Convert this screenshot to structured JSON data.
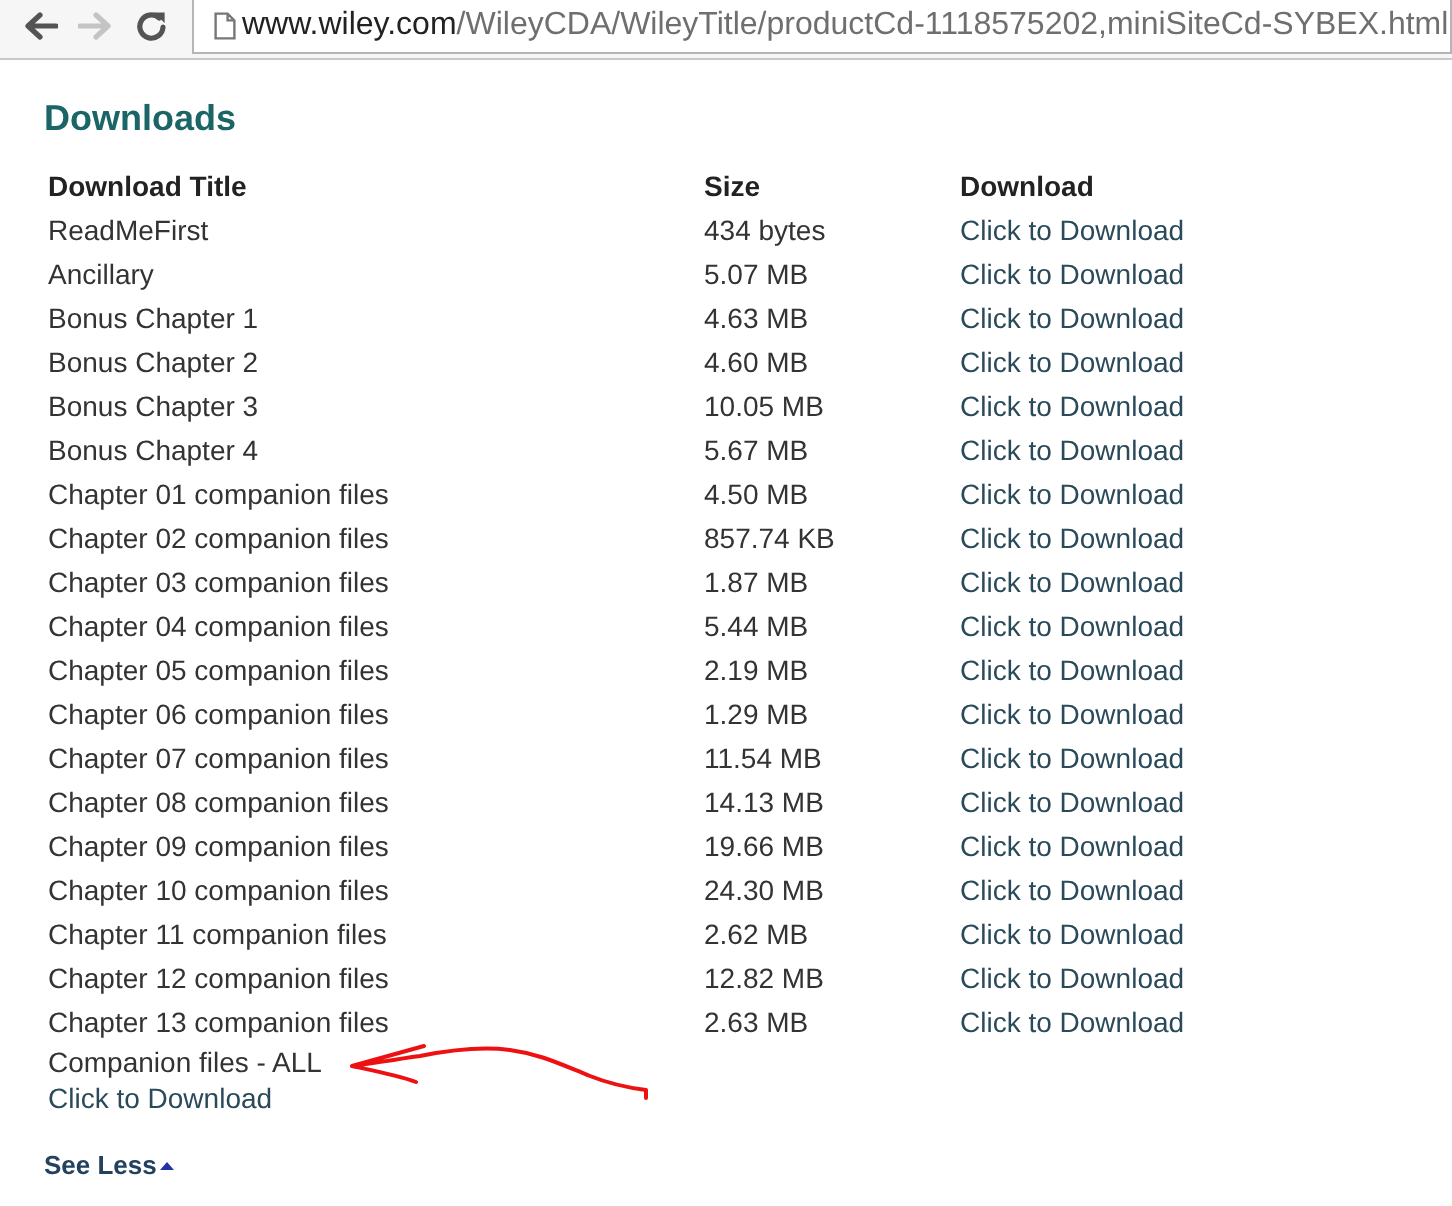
{
  "browser": {
    "nav_buttons": [
      {
        "kind": "back",
        "disabled": false
      },
      {
        "kind": "forward",
        "disabled": true
      },
      {
        "kind": "reload",
        "disabled": false
      }
    ],
    "address": {
      "host": "www.wiley.com",
      "path": "/WileyCDA/WileyTitle/productCd-1118575202,miniSiteCd-SYBEX.html"
    }
  },
  "downloads": {
    "title": "Downloads",
    "table": {
      "columns": [
        "Download Title",
        "Size",
        "Download"
      ],
      "rows": [
        {
          "title": "ReadMeFirst",
          "size": "434 bytes",
          "link": "Click to Download"
        },
        {
          "title": "Ancillary",
          "size": "5.07 MB",
          "link": "Click to Download"
        },
        {
          "title": "Bonus Chapter 1",
          "size": "4.63 MB",
          "link": "Click to Download"
        },
        {
          "title": "Bonus Chapter 2",
          "size": "4.60 MB",
          "link": "Click to Download"
        },
        {
          "title": "Bonus Chapter 3",
          "size": "10.05 MB",
          "link": "Click to Download"
        },
        {
          "title": "Bonus Chapter 4",
          "size": "5.67 MB",
          "link": "Click to Download"
        },
        {
          "title": "Chapter 01 companion files",
          "size": "4.50 MB",
          "link": "Click to Download"
        },
        {
          "title": "Chapter 02 companion files",
          "size": "857.74 KB",
          "link": "Click to Download"
        },
        {
          "title": "Chapter 03 companion files",
          "size": "1.87 MB",
          "link": "Click to Download"
        },
        {
          "title": "Chapter 04 companion files",
          "size": "5.44 MB",
          "link": "Click to Download"
        },
        {
          "title": "Chapter 05 companion files",
          "size": "2.19 MB",
          "link": "Click to Download"
        },
        {
          "title": "Chapter 06 companion files",
          "size": "1.29 MB",
          "link": "Click to Download"
        },
        {
          "title": "Chapter 07 companion files",
          "size": "11.54 MB",
          "link": "Click to Download"
        },
        {
          "title": "Chapter 08 companion files",
          "size": "14.13 MB",
          "link": "Click to Download"
        },
        {
          "title": "Chapter 09 companion files",
          "size": "19.66 MB",
          "link": "Click to Download"
        },
        {
          "title": "Chapter 10 companion files",
          "size": "24.30 MB",
          "link": "Click to Download"
        },
        {
          "title": "Chapter 11 companion files",
          "size": "2.62 MB",
          "link": "Click to Download"
        },
        {
          "title": "Chapter 12 companion files",
          "size": "12.82 MB",
          "link": "Click to Download"
        },
        {
          "title": "Chapter 13 companion files",
          "size": "2.63 MB",
          "link": "Click to Download"
        }
      ]
    },
    "all_files": {
      "title": "Companion files - ALL",
      "link": "Click to Download"
    },
    "toggle": {
      "label": "See Less",
      "expanded": true
    }
  }
}
